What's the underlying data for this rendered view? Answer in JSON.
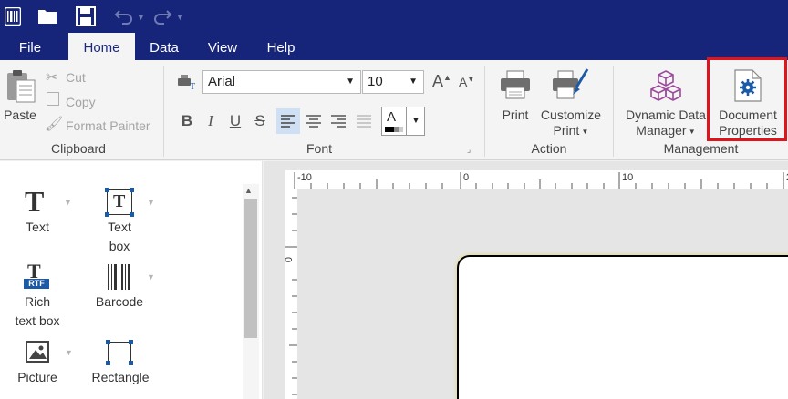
{
  "toolbar": {
    "app_icon": "barcode-app-icon",
    "open_icon": "folder-icon",
    "save_icon": "save-icon",
    "undo_icon": "undo-icon",
    "redo_icon": "redo-icon"
  },
  "tabs": [
    {
      "label": "File",
      "active": false
    },
    {
      "label": "Home",
      "active": true
    },
    {
      "label": "Data",
      "active": false
    },
    {
      "label": "View",
      "active": false
    },
    {
      "label": "Help",
      "active": false
    }
  ],
  "clipboard": {
    "paste": "Paste",
    "cut": "Cut",
    "copy": "Copy",
    "format_painter": "Format Painter",
    "group": "Clipboard"
  },
  "font": {
    "family": "Arial",
    "size": "10",
    "color_letter": "A",
    "group": "Font"
  },
  "action": {
    "print": "Print",
    "customize": "Customize",
    "customize_line2": "Print",
    "group": "Action"
  },
  "management": {
    "dynamic": "Dynamic Data",
    "dynamic_line2": "Manager",
    "document": "Document",
    "document_line2": "Properties",
    "group": "Management"
  },
  "tools": [
    {
      "label": "Text",
      "label2": ""
    },
    {
      "label": "Text",
      "label2": "box"
    },
    {
      "label": "Rich",
      "label2": "text box"
    },
    {
      "label": "Barcode",
      "label2": ""
    },
    {
      "label": "Picture",
      "label2": ""
    },
    {
      "label": "Rectangle",
      "label2": ""
    }
  ],
  "tool_icons": {
    "rtf_badge": "RTF",
    "text_glyph": "T"
  },
  "ruler": {
    "top": [
      "-10",
      "0",
      "10",
      "2"
    ],
    "left": [
      "0"
    ]
  },
  "colors": {
    "title_bar": "#16247a",
    "highlight": "#e0141c",
    "accent_purple": "#9b4a9a",
    "accent_blue": "#1b5aa6"
  }
}
